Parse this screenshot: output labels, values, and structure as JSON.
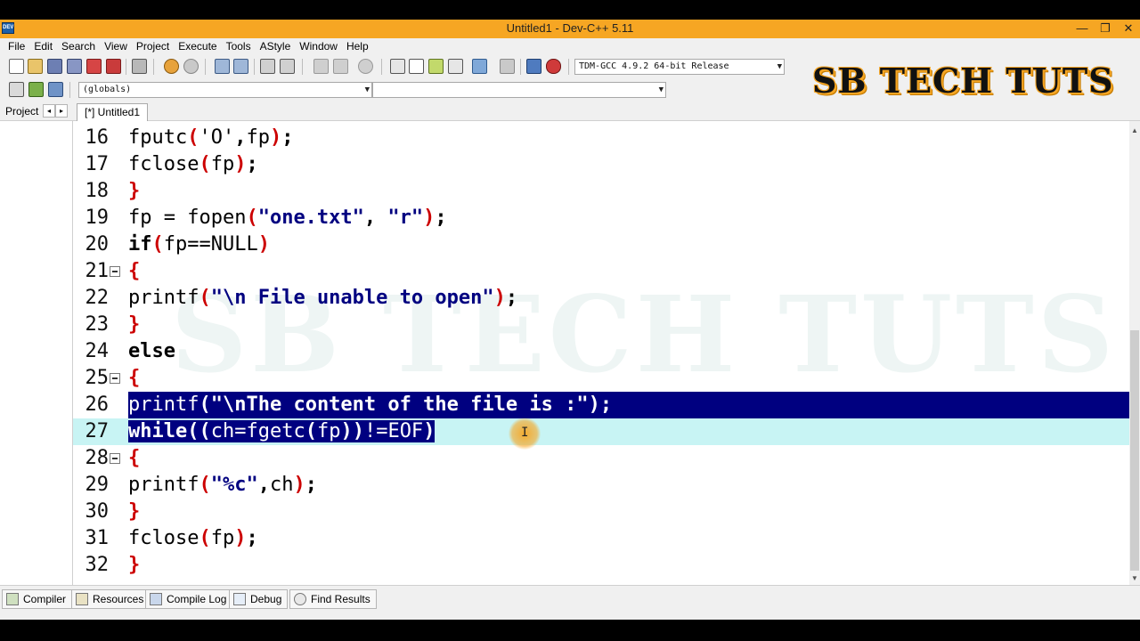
{
  "window": {
    "title": "Untitled1 - Dev-C++ 5.11",
    "app_icon_text": "DEV",
    "controls": [
      "—",
      "❐",
      "✕"
    ]
  },
  "menu": [
    "File",
    "Edit",
    "Search",
    "View",
    "Project",
    "Execute",
    "Tools",
    "AStyle",
    "Window",
    "Help"
  ],
  "toolbar": {
    "compiler_select": "TDM-GCC 4.9.2 64-bit Release",
    "scope_select": "(globals)",
    "member_select": ""
  },
  "watermark": "SB TECH TUTS",
  "project_panel": {
    "label": "Project",
    "prev": "◂",
    "next": "▸"
  },
  "editor": {
    "tab_label": "[*] Untitled1",
    "lines": [
      {
        "n": "16",
        "code": "fputc('O',fp);"
      },
      {
        "n": "17",
        "code": "fclose(fp);"
      },
      {
        "n": "18",
        "code": "}"
      },
      {
        "n": "19",
        "code": "fp = fopen(\"one.txt\", \"r\");"
      },
      {
        "n": "20",
        "code": "if(fp==NULL)"
      },
      {
        "n": "21",
        "code": "{"
      },
      {
        "n": "22",
        "code": "printf(\"\\n File unable to open\");"
      },
      {
        "n": "23",
        "code": "}"
      },
      {
        "n": "24",
        "code": "else"
      },
      {
        "n": "25",
        "code": "{"
      },
      {
        "n": "26",
        "code": "printf(\"\\nThe content of the file is :\");"
      },
      {
        "n": "27",
        "code": "while((ch=fgetc(fp))!=EOF)"
      },
      {
        "n": "28",
        "code": "{"
      },
      {
        "n": "29",
        "code": "printf(\"%c\",ch);"
      },
      {
        "n": "30",
        "code": "}"
      },
      {
        "n": "31",
        "code": "fclose(fp);"
      },
      {
        "n": "32",
        "code": "}"
      }
    ]
  },
  "bottom_tabs": [
    "Compiler",
    "Resources",
    "Compile Log",
    "Debug",
    "Find Results"
  ],
  "colors": {
    "titlebar": "#f6a623",
    "selection": "#000080",
    "current_line": "#c8f4f4",
    "brace": "#cc0000",
    "string": "#000080"
  }
}
